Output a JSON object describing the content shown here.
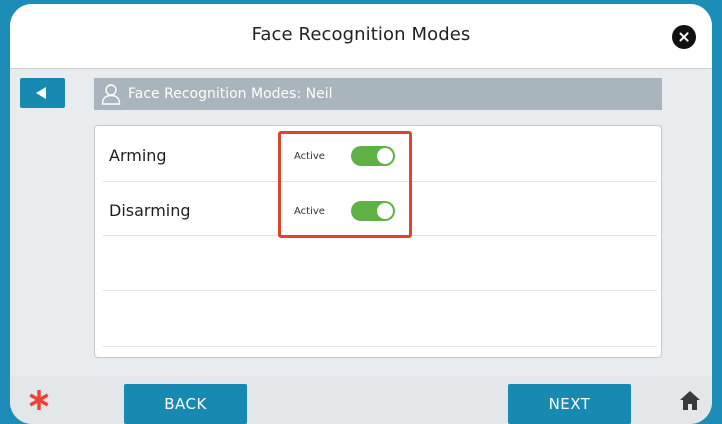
{
  "header": {
    "title": "Face Recognition Modes"
  },
  "profile": {
    "label": "Face Recognition Modes: Neil"
  },
  "modes": [
    {
      "label": "Arming",
      "status": "Active",
      "enabled": true
    },
    {
      "label": "Disarming",
      "status": "Active",
      "enabled": true
    }
  ],
  "footer": {
    "back_label": "BACK",
    "next_label": "NEXT"
  },
  "colors": {
    "accent": "#1889b0",
    "toggle_on": "#5fb146",
    "highlight": "#e0452a",
    "emergency": "#ef4135"
  },
  "icons": {
    "close": "close-icon",
    "back": "back-arrow-icon",
    "user": "user-icon",
    "emergency": "asterisk-icon",
    "home": "home-icon"
  }
}
